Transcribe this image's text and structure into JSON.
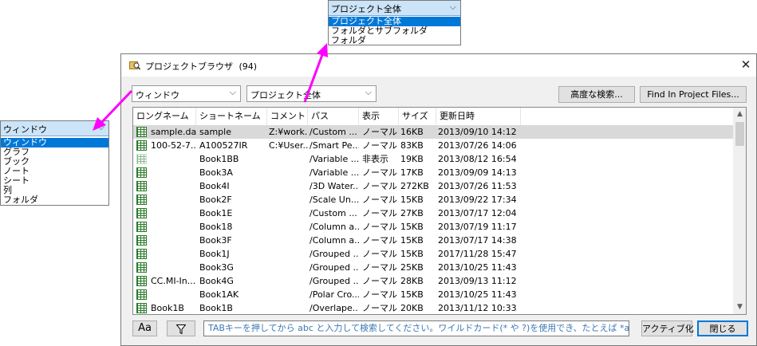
{
  "window": {
    "title": "プロジェクトブラウザ",
    "count": "(94)",
    "close_glyph": "✕"
  },
  "toolbar": {
    "scope_combo_value": "ウィンドウ",
    "project_combo_value": "プロジェクト全体",
    "advanced_search_label": "高度な検索...",
    "find_in_project_label": "Find In Project Files..."
  },
  "table": {
    "columns": [
      "ロングネーム",
      "ショートネーム",
      "コメント",
      "パス",
      "表示",
      "サイズ",
      "更新日時"
    ],
    "rows": [
      {
        "long": "sample.dat",
        "short": "sample",
        "comment": "Z:¥work...",
        "path": "/Custom ...",
        "show": "ノーマル",
        "size": "16KB",
        "date": "2013/09/10 14:12",
        "hidden": false,
        "selected": true
      },
      {
        "long": "100-52-7...",
        "short": "A100527IR",
        "comment": "C:¥User...",
        "path": "/Smart Pe...",
        "show": "ノーマル",
        "size": "83KB",
        "date": "2013/07/26 14:06",
        "hidden": false,
        "selected": false
      },
      {
        "long": "",
        "short": "Book1BB",
        "comment": "",
        "path": "/Variable ...",
        "show": "非表示",
        "size": "19KB",
        "date": "2013/08/12 16:54",
        "hidden": true,
        "selected": false
      },
      {
        "long": "",
        "short": "Book3A",
        "comment": "",
        "path": "/Variable ...",
        "show": "ノーマル",
        "size": "17KB",
        "date": "2013/09/09 14:13",
        "hidden": false,
        "selected": false
      },
      {
        "long": "",
        "short": "Book4I",
        "comment": "",
        "path": "/3D Water...",
        "show": "ノーマル",
        "size": "272KB",
        "date": "2013/07/26 11:53",
        "hidden": false,
        "selected": false
      },
      {
        "long": "",
        "short": "Book2F",
        "comment": "",
        "path": "/Scale Un...",
        "show": "ノーマル",
        "size": "15KB",
        "date": "2013/09/22 17:34",
        "hidden": false,
        "selected": false
      },
      {
        "long": "",
        "short": "Book1E",
        "comment": "",
        "path": "/Custom ...",
        "show": "ノーマル",
        "size": "27KB",
        "date": "2013/07/17 12:04",
        "hidden": false,
        "selected": false
      },
      {
        "long": "",
        "short": "Book18",
        "comment": "",
        "path": "/Column a...",
        "show": "ノーマル",
        "size": "15KB",
        "date": "2013/07/19 11:17",
        "hidden": false,
        "selected": false
      },
      {
        "long": "",
        "short": "Book3F",
        "comment": "",
        "path": "/Column a...",
        "show": "ノーマル",
        "size": "15KB",
        "date": "2013/07/17 14:38",
        "hidden": false,
        "selected": false
      },
      {
        "long": "",
        "short": "Book1J",
        "comment": "",
        "path": "/Grouped ...",
        "show": "ノーマル",
        "size": "15KB",
        "date": "2017/11/28 15:47",
        "hidden": false,
        "selected": false
      },
      {
        "long": "",
        "short": "Book3G",
        "comment": "",
        "path": "/Grouped ...",
        "show": "ノーマル",
        "size": "25KB",
        "date": "2013/10/25 11:43",
        "hidden": false,
        "selected": false
      },
      {
        "long": "CC.MI-In...",
        "short": "Book4G",
        "comment": "",
        "path": "/Grouped ...",
        "show": "ノーマル",
        "size": "28KB",
        "date": "2013/09/13 11:12",
        "hidden": false,
        "selected": false
      },
      {
        "long": "",
        "short": "Book1AK",
        "comment": "",
        "path": "/Polar Cro...",
        "show": "ノーマル",
        "size": "15KB",
        "date": "2013/10/25 11:43",
        "hidden": false,
        "selected": false
      },
      {
        "long": "Book1B",
        "short": "Book1B",
        "comment": "",
        "path": "/Overlape...",
        "show": "ノーマル",
        "size": "20KB",
        "date": "2013/11/12 10:33",
        "hidden": false,
        "selected": false
      }
    ]
  },
  "bottom": {
    "font_button_label": "Aa",
    "filter_icon": "filter-icon",
    "search_placeholder": "TABキーを押してから abc と入力して検索してください。ワイルドカード(* や ?)を使用でき、たとえば *abc",
    "activate_label": "アクティブ化",
    "close_label": "閉じる"
  },
  "popup_project": {
    "value": "プロジェクト全体",
    "options": [
      "プロジェクト全体",
      "フォルダとサブフォルダ",
      "フォルダ"
    ],
    "selected_index": 0
  },
  "popup_scope": {
    "value": "ウィンドウ",
    "options": [
      "ウィンドウ",
      "グラフ",
      "ブック",
      "ノート",
      "シート",
      "列",
      "フォルダ"
    ],
    "selected_index": 0
  },
  "colors": {
    "annotation_arrow": "#ff00ff",
    "selection_blue": "#0078d7",
    "workbook_green": "#2a7a2a"
  }
}
